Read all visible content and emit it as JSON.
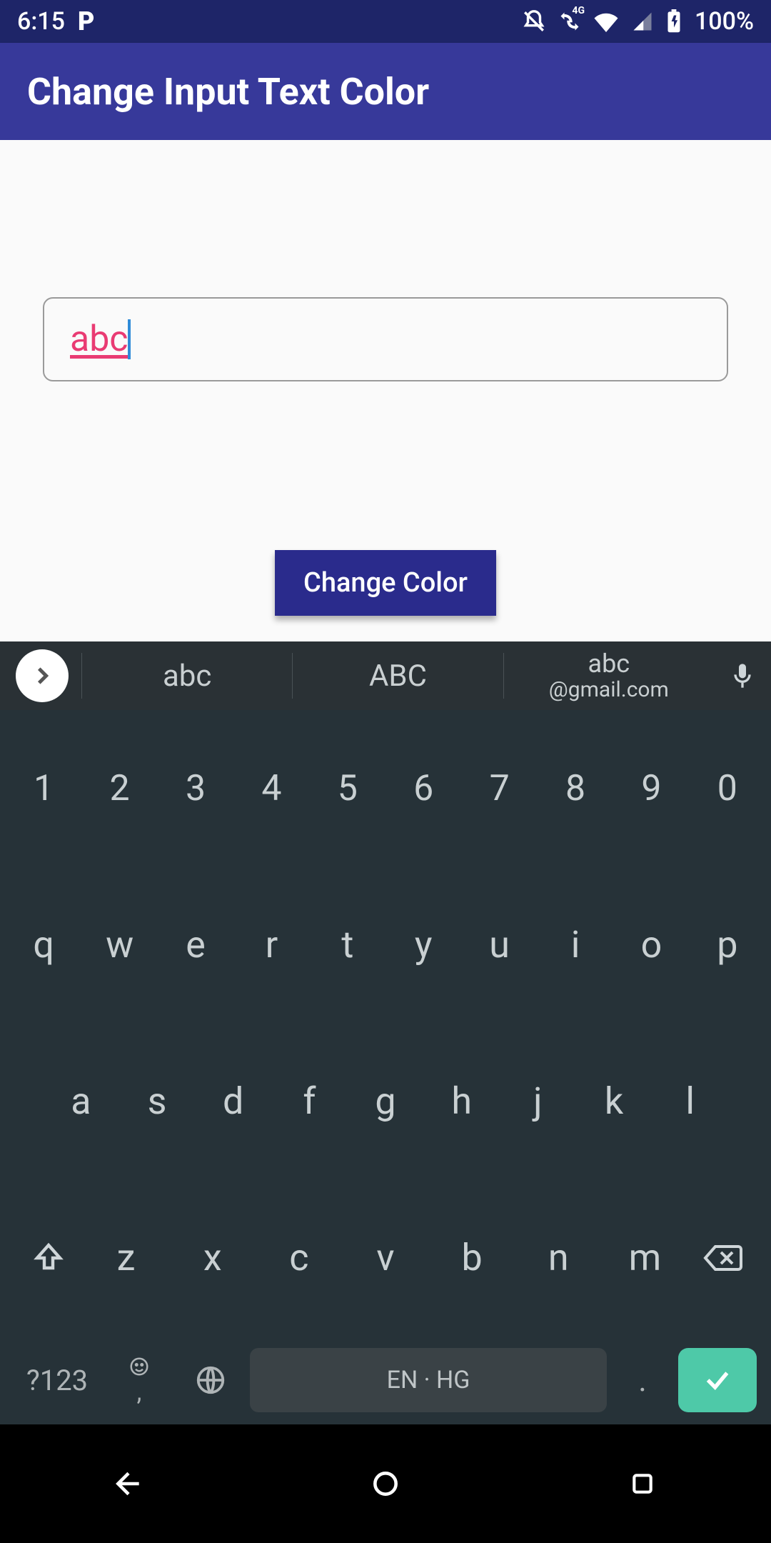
{
  "status": {
    "time": "6:15",
    "battery_pct": "100%"
  },
  "app": {
    "title": "Change Input Text Color"
  },
  "input": {
    "value": "abc",
    "text_color": "#e93b73"
  },
  "button": {
    "label": "Change Color"
  },
  "keyboard": {
    "suggestions": {
      "s1": "abc",
      "s2": "ABC",
      "s3_top": "abc",
      "s3_bottom": "@gmail.com"
    },
    "rows": {
      "numbers": [
        "1",
        "2",
        "3",
        "4",
        "5",
        "6",
        "7",
        "8",
        "9",
        "0"
      ],
      "r1": [
        "q",
        "w",
        "e",
        "r",
        "t",
        "y",
        "u",
        "i",
        "o",
        "p"
      ],
      "r2": [
        "a",
        "s",
        "d",
        "f",
        "g",
        "h",
        "j",
        "k",
        "l"
      ],
      "r3": [
        "z",
        "x",
        "c",
        "v",
        "b",
        "n",
        "m"
      ]
    },
    "bottom": {
      "symbols": "?123",
      "comma": ",",
      "space": "EN · HG",
      "period": "."
    }
  }
}
